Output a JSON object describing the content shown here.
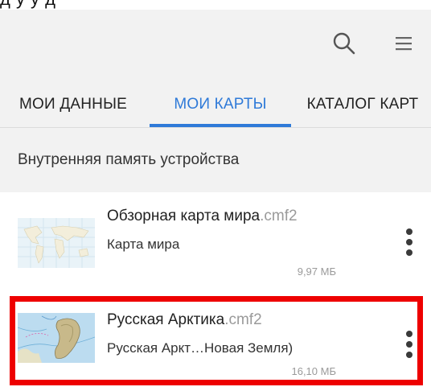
{
  "top_fragment": "д  у   у д",
  "appbar": {
    "search_icon": "search-icon",
    "menu_icon": "menu-icon"
  },
  "tabs": [
    {
      "label": "МОИ ДАННЫЕ",
      "selected": false
    },
    {
      "label": "МОИ КАРТЫ",
      "selected": true
    },
    {
      "label": "КАТАЛОГ КАРТ",
      "selected": false
    }
  ],
  "colors": {
    "accent": "#2f7ad8",
    "highlight": "#ee0000",
    "background": "#f2f2f2"
  },
  "section_header": "Внутренняя память устройства",
  "items": [
    {
      "name": "Обзорная карта мира",
      "ext": ".cmf2",
      "subtitle": "Карта мира",
      "size": "9,97 МБ",
      "more_icon": "more-vertical-icon"
    },
    {
      "name": "Русская Арктика",
      "ext": ".cmf2",
      "subtitle": "Русская Аркт…Новая Земля)",
      "size": "16,10 МБ",
      "more_icon": "more-vertical-icon"
    }
  ]
}
